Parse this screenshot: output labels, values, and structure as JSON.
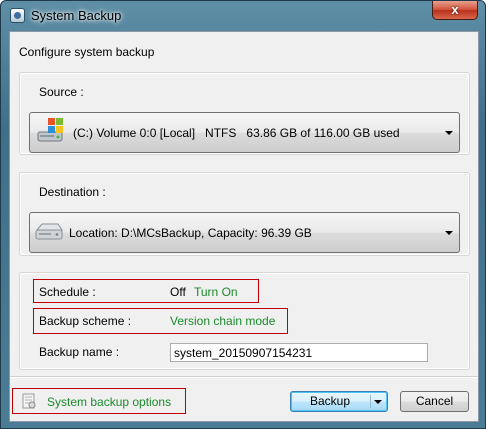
{
  "window": {
    "title": "System Backup",
    "close_glyph": "x"
  },
  "heading": "Configure system backup",
  "source": {
    "label": "Source :",
    "icon": "windows-disk-icon",
    "selected": "(C:) Volume 0:0 [Local]   NTFS   63.86 GB of 116.00 GB used"
  },
  "destination": {
    "label": "Destination :",
    "icon": "drive-icon",
    "selected": "Location: D:\\MCsBackup, Capacity: 96.39 GB"
  },
  "schedule": {
    "label": "Schedule :",
    "value": "Off",
    "action": "Turn On"
  },
  "backup_scheme": {
    "label": "Backup scheme :",
    "value": "Version chain mode"
  },
  "backup_name": {
    "label": "Backup name :",
    "value": "system_20150907154231"
  },
  "footer": {
    "options_link": "System backup options",
    "backup_button": "Backup",
    "cancel_button": "Cancel"
  },
  "colors": {
    "link_green": "#1b8a2b",
    "highlight_red": "#c00000",
    "title_bar": "#4a7d95"
  }
}
